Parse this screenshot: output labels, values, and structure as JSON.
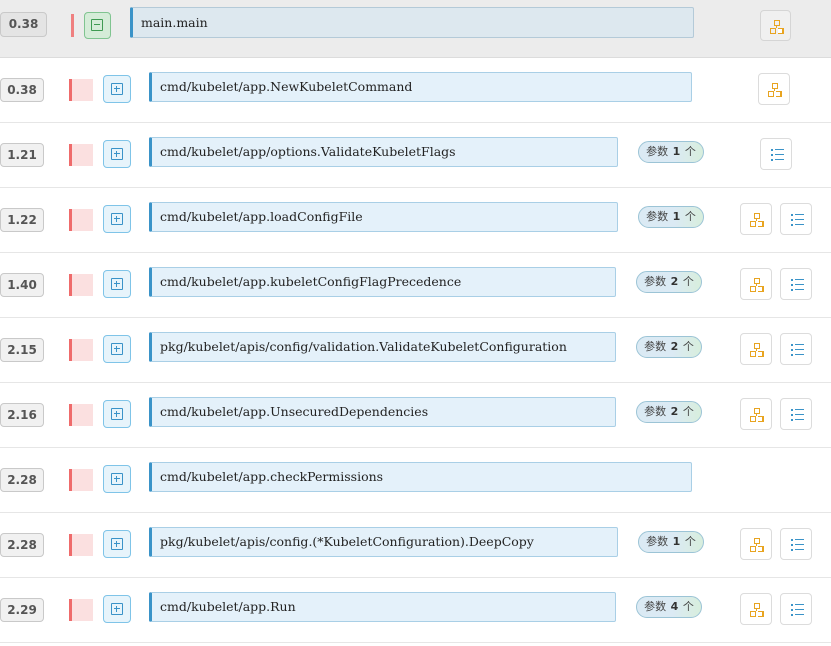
{
  "rows": [
    {
      "time": "0.38",
      "func": "main.main",
      "expanded": true,
      "params": null,
      "call_tree": true,
      "detail": false
    },
    {
      "time": "0.38",
      "func": "cmd/kubelet/app.NewKubeletCommand",
      "expanded": false,
      "params": null,
      "call_tree": true,
      "detail": false
    },
    {
      "time": "1.21",
      "func": "cmd/kubelet/app/options.ValidateKubeletFlags",
      "expanded": false,
      "params": {
        "label": "参数",
        "count": "1",
        "unit": "个"
      },
      "call_tree": false,
      "detail": true
    },
    {
      "time": "1.22",
      "func": "cmd/kubelet/app.loadConfigFile",
      "expanded": false,
      "params": {
        "label": "参数",
        "count": "1",
        "unit": "个"
      },
      "call_tree": true,
      "detail": true
    },
    {
      "time": "1.40",
      "func": "cmd/kubelet/app.kubeletConfigFlagPrecedence",
      "expanded": false,
      "params": {
        "label": "参数",
        "count": "2",
        "unit": "个"
      },
      "call_tree": true,
      "detail": true
    },
    {
      "time": "2.15",
      "func": "pkg/kubelet/apis/config/validation.ValidateKubeletConfiguration",
      "expanded": false,
      "params": {
        "label": "参数",
        "count": "2",
        "unit": "个"
      },
      "call_tree": true,
      "detail": true
    },
    {
      "time": "2.16",
      "func": "cmd/kubelet/app.UnsecuredDependencies",
      "expanded": false,
      "params": {
        "label": "参数",
        "count": "2",
        "unit": "个"
      },
      "call_tree": true,
      "detail": true
    },
    {
      "time": "2.28",
      "func": "cmd/kubelet/app.checkPermissions",
      "expanded": false,
      "params": null,
      "call_tree": false,
      "detail": false
    },
    {
      "time": "2.28",
      "func": "pkg/kubelet/apis/config.(*KubeletConfiguration).DeepCopy",
      "expanded": false,
      "params": {
        "label": "参数",
        "count": "1",
        "unit": "个"
      },
      "call_tree": true,
      "detail": true
    },
    {
      "time": "2.29",
      "func": "cmd/kubelet/app.Run",
      "expanded": false,
      "params": {
        "label": "参数",
        "count": "4",
        "unit": "个"
      },
      "call_tree": true,
      "detail": true
    }
  ],
  "icons": {
    "expand": "plus-square-icon",
    "collapse": "minus-square-icon",
    "call_tree": "sitemap-icon",
    "detail": "list-icon"
  },
  "colors": {
    "accent": "#3a93c8",
    "warn": "#ef6b6b",
    "tree": "#e8a420",
    "expanded": "#3f9a52"
  }
}
